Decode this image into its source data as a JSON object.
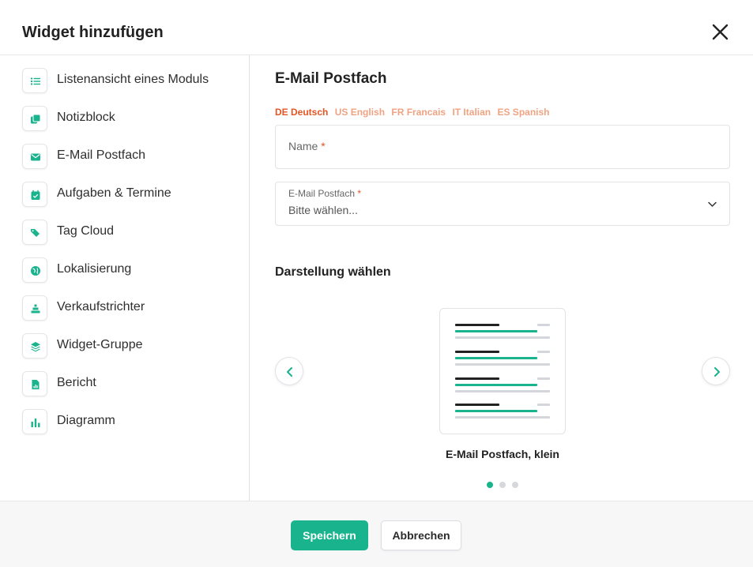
{
  "dialog": {
    "title": "Widget hinzufügen"
  },
  "sidebar": {
    "items": [
      {
        "label": "Listenansicht eines Moduls",
        "icon": "list-icon"
      },
      {
        "label": "Notizblock",
        "icon": "notes-icon"
      },
      {
        "label": "E-Mail Postfach",
        "icon": "envelope-icon"
      },
      {
        "label": "Aufgaben & Termine",
        "icon": "calendar-check-icon"
      },
      {
        "label": "Tag Cloud",
        "icon": "tags-icon"
      },
      {
        "label": "Lokalisierung",
        "icon": "globe-icon"
      },
      {
        "label": "Verkaufstrichter",
        "icon": "funnel-icon"
      },
      {
        "label": "Widget-Gruppe",
        "icon": "layers-icon"
      },
      {
        "label": "Bericht",
        "icon": "report-file-icon"
      },
      {
        "label": "Diagramm",
        "icon": "bar-chart-icon"
      }
    ]
  },
  "main": {
    "title": "E-Mail Postfach",
    "languages": [
      {
        "label": "DE Deutsch",
        "active": true
      },
      {
        "label": "US English",
        "active": false
      },
      {
        "label": "FR Francais",
        "active": false
      },
      {
        "label": "IT Italian",
        "active": false
      },
      {
        "label": "ES Spanish",
        "active": false
      }
    ],
    "name_field": {
      "placeholder": "Name",
      "required_mark": "*"
    },
    "mailbox_field": {
      "label": "E-Mail Postfach",
      "required_mark": "*",
      "value": "Bitte wählen..."
    },
    "display_heading": "Darstellung wählen",
    "carousel": {
      "caption": "E-Mail Postfach, klein",
      "current_page": 1,
      "page_count": 3
    }
  },
  "footer": {
    "save_label": "Speichern",
    "cancel_label": "Abbrechen"
  },
  "colors": {
    "accent": "#19b38d",
    "language_active": "#e55422",
    "language_inactive": "#f0a383"
  }
}
